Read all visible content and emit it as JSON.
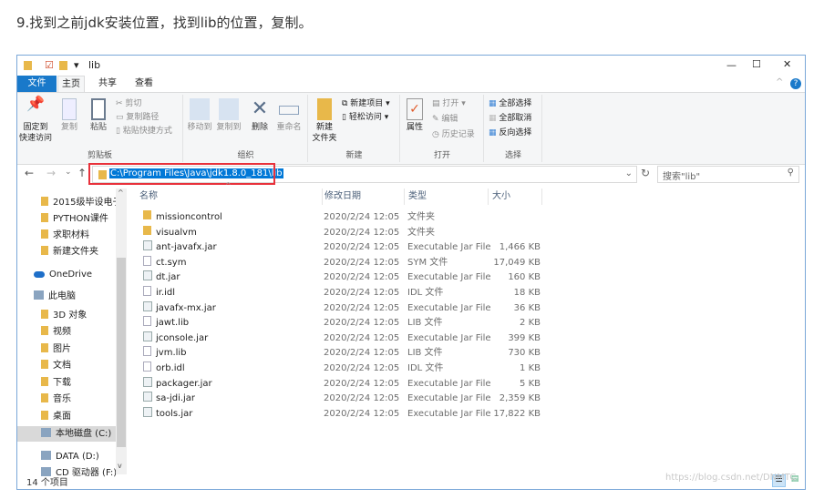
{
  "caption": "9.找到之前jdk安装位置，找到lib的位置，复制。",
  "window": {
    "title": "lib",
    "minimize": "—",
    "maximize": "☐",
    "close": "✕"
  },
  "tabs": [
    "文件",
    "主页",
    "共享",
    "查看"
  ],
  "ribbon": {
    "clipboard": {
      "label": "剪贴板",
      "pin": "固定到\n快速访问",
      "copy": "复制",
      "paste": "粘贴",
      "cut": "剪切",
      "copy_path": "复制路径",
      "paste_shortcut": "粘贴快捷方式"
    },
    "organize": {
      "label": "组织",
      "move_to": "移动到",
      "copy_to": "复制到",
      "delete": "删除",
      "rename": "重命名"
    },
    "new": {
      "label": "新建",
      "new_folder": "新建\n文件夹",
      "new_item": "新建项目",
      "easy_access": "轻松访问"
    },
    "open": {
      "label": "打开",
      "properties": "属性",
      "open": "打开",
      "edit": "编辑",
      "history": "历史记录"
    },
    "select": {
      "label": "选择",
      "select_all": "全部选择",
      "select_none": "全部取消",
      "invert": "反向选择"
    }
  },
  "address": {
    "path": "C:\\Program Files\\Java\\jdk1.8.0_181\\lib",
    "search_placeholder": "搜索\"lib\""
  },
  "sidebar": [
    "2015级毕设电子",
    "PYTHON课件",
    "求职材料",
    "新建文件夹",
    "OneDrive",
    "此电脑",
    "3D 对象",
    "视频",
    "图片",
    "文档",
    "下载",
    "音乐",
    "桌面",
    "本地磁盘 (C:)",
    "DATA (D:)",
    "CD 驱动器 (F:)"
  ],
  "columns": [
    "名称",
    "修改日期",
    "类型",
    "大小"
  ],
  "files": [
    {
      "name": "missioncontrol",
      "date": "2020/2/24 12:05",
      "type": "文件夹",
      "size": "",
      "icon": "folder"
    },
    {
      "name": "visualvm",
      "date": "2020/2/24 12:05",
      "type": "文件夹",
      "size": "",
      "icon": "folder"
    },
    {
      "name": "ant-javafx.jar",
      "date": "2020/2/24 12:05",
      "type": "Executable Jar File",
      "size": "1,466 KB",
      "icon": "jar"
    },
    {
      "name": "ct.sym",
      "date": "2020/2/24 12:05",
      "type": "SYM 文件",
      "size": "17,049 KB",
      "icon": "doc"
    },
    {
      "name": "dt.jar",
      "date": "2020/2/24 12:05",
      "type": "Executable Jar File",
      "size": "160 KB",
      "icon": "jar"
    },
    {
      "name": "ir.idl",
      "date": "2020/2/24 12:05",
      "type": "IDL 文件",
      "size": "18 KB",
      "icon": "doc"
    },
    {
      "name": "javafx-mx.jar",
      "date": "2020/2/24 12:05",
      "type": "Executable Jar File",
      "size": "36 KB",
      "icon": "jar"
    },
    {
      "name": "jawt.lib",
      "date": "2020/2/24 12:05",
      "type": "LIB 文件",
      "size": "2 KB",
      "icon": "doc"
    },
    {
      "name": "jconsole.jar",
      "date": "2020/2/24 12:05",
      "type": "Executable Jar File",
      "size": "399 KB",
      "icon": "jar"
    },
    {
      "name": "jvm.lib",
      "date": "2020/2/24 12:05",
      "type": "LIB 文件",
      "size": "730 KB",
      "icon": "doc"
    },
    {
      "name": "orb.idl",
      "date": "2020/2/24 12:05",
      "type": "IDL 文件",
      "size": "1 KB",
      "icon": "doc"
    },
    {
      "name": "packager.jar",
      "date": "2020/2/24 12:05",
      "type": "Executable Jar File",
      "size": "5 KB",
      "icon": "jar"
    },
    {
      "name": "sa-jdi.jar",
      "date": "2020/2/24 12:05",
      "type": "Executable Jar File",
      "size": "2,359 KB",
      "icon": "jar"
    },
    {
      "name": "tools.jar",
      "date": "2020/2/24 12:05",
      "type": "Executable Jar File",
      "size": "17,822 KB",
      "icon": "jar"
    }
  ],
  "status": "14 个项目",
  "watermark": "https://blog.csdn.net/DNMTC"
}
